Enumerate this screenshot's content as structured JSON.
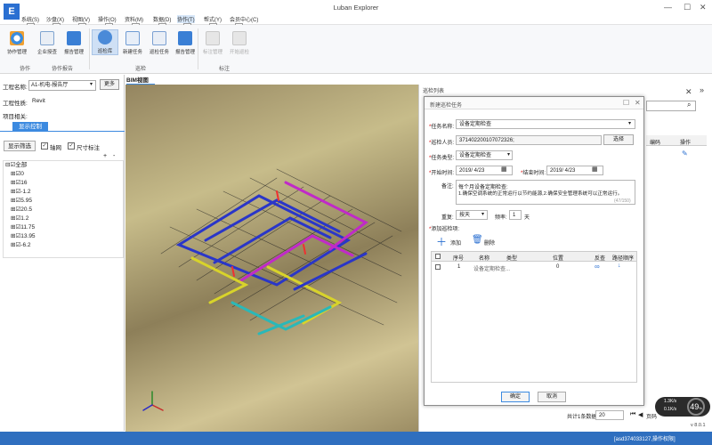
{
  "app": {
    "logo": "E",
    "title": "Luban Explorer"
  },
  "menu": [
    "系统(S)",
    "沙盘(X)",
    "视图(V)",
    "操作(O)",
    "资料(M)",
    "数据(D)",
    "协作(T)",
    "帮式(Y)",
    "会员中心(C)"
  ],
  "keytips": [
    "S",
    "X",
    "V",
    "O",
    "M",
    "D",
    "T",
    "Y",
    "C"
  ],
  "ribbon": {
    "buttons": [
      "协作管理",
      "企业授查",
      "报告管理",
      "巡检库",
      "新建任务",
      "巡检任务",
      "报告管理",
      "标注管理",
      "开始巡检"
    ],
    "groups": [
      "协作",
      "协作报告",
      "巡检",
      "标注"
    ]
  },
  "left": {
    "project_label": "工程名称:",
    "project_value": "A1-机电-报告厅",
    "more": "更多",
    "type_label": "工程性质:",
    "type_value": "Revit",
    "related_label": "项目相关:",
    "display_tab": "显示控制",
    "filter_btn": "显示筛选",
    "hole_label": "轴网",
    "dim_label": "尺寸标注",
    "plus": "+",
    "minus": "-",
    "tree": [
      "全部",
      "0",
      "16",
      "-1.2",
      "5.95",
      "20.5",
      "1.2",
      "11.75",
      "13.95",
      "-6.2"
    ]
  },
  "viewer": {
    "tab": "BIM视图"
  },
  "right": {
    "title": "巡检列表",
    "col_code": "编码",
    "col_op": "操作",
    "total": "共计1条数据",
    "page_size": "20",
    "page_label": "页码",
    "speed_up": "1.3K/s",
    "speed_down": "0.1K/s",
    "cpu": "49",
    "cpu_unit": "%",
    "version": "v 8.0.1"
  },
  "dialog": {
    "title": "新建巡检任务",
    "task_name_label": "任务名称:",
    "task_name": "设备定期检查",
    "inspector_label": "巡检人员:",
    "inspector": "371402200107072326;",
    "select_btn": "选择",
    "task_type_label": "任务类型:",
    "task_type": "设备定期检查",
    "start_label": "开始时间:",
    "start_date": "2019/ 4/23",
    "end_label": "结束时间:",
    "end_date": "2019/ 4/23",
    "note_label": "备注:",
    "note_line1": "每个月设备定期检查:",
    "note_line2": "1.确保空调系统的正常运行以节约能源,2.确保安全管理系统可以正常运行。",
    "note_count": "(47/150)",
    "repeat_label": "重复:",
    "repeat_value": "按天",
    "freq_label": "频率:",
    "freq_value": "1",
    "freq_unit": "天",
    "items_label": "添加巡检项:",
    "add": "添加",
    "delete": "删除",
    "columns": [
      "序号",
      "名称",
      "类型",
      "位置",
      "反查",
      "路径顺序"
    ],
    "rows": [
      {
        "index": "1",
        "name": "设备定期检查...",
        "type": "",
        "pos": "0"
      }
    ],
    "ok": "确定",
    "cancel": "取消"
  },
  "status": {
    "user": "[asd374033127,操作权限]"
  }
}
